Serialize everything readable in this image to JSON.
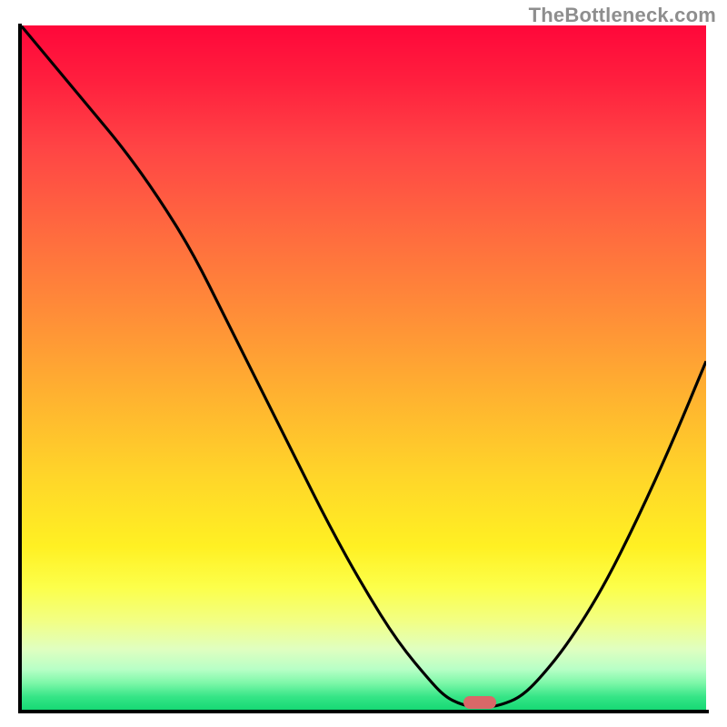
{
  "attribution": "TheBottleneck.com",
  "colors": {
    "axis": "#000000",
    "curve": "#000000",
    "marker": "#d96868",
    "attribution_text": "#8e8e8e",
    "gradient_top": "#ff073a",
    "gradient_bottom": "#14d873"
  },
  "chart_data": {
    "type": "line",
    "title": "",
    "xlabel": "",
    "ylabel": "",
    "xlim": [
      0,
      100
    ],
    "ylim": [
      0,
      100
    ],
    "x": [
      0,
      5,
      10,
      15,
      20,
      25,
      30,
      35,
      40,
      45,
      50,
      55,
      60,
      62,
      64,
      66,
      68,
      70,
      73,
      76,
      80,
      85,
      90,
      95,
      100
    ],
    "y": [
      100,
      94,
      88,
      82,
      75,
      67,
      57,
      47,
      37,
      27,
      18,
      10,
      4,
      2,
      1,
      0.5,
      0.5,
      0.8,
      2,
      5,
      10,
      18,
      28,
      39,
      51
    ],
    "optimum_marker": {
      "x": 67,
      "y": 1.2
    },
    "notes": "V-shaped bottleneck curve over a red→green vertical gradient; minimum ≈ x=67. No numeric axis ticks are shown in the source image; values are estimated from curve geometry on a 0–100 normalized scale."
  }
}
